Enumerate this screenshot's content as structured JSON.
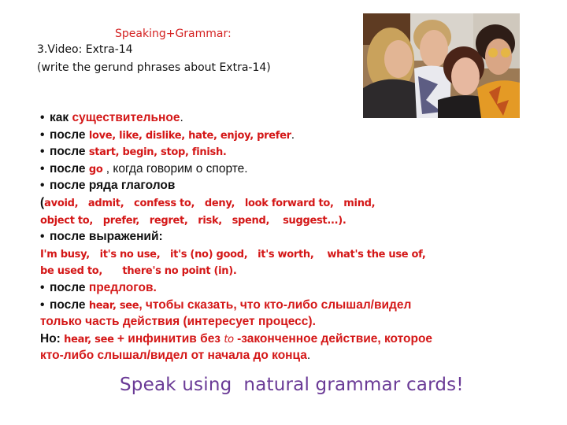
{
  "header": {
    "title": "Speaking+Grammar:",
    "video": "3.Video: Extra-14",
    "task": "(write the gerund phrases about Extra-14)"
  },
  "photo": {
    "alt": "Four cast members of Extra-14 posing together",
    "icon": "photo-image"
  },
  "colors": {
    "accent_red": "#d41717",
    "footer_purple": "#6a3a96",
    "text": "#111111"
  },
  "rules": {
    "l1": {
      "bullet": "•",
      "a": "как ",
      "b": "существительное",
      "c": "."
    },
    "l2": {
      "bullet": "•",
      "a": "после ",
      "b": "love, like, dislike, hate, enjoy, prefer",
      "c": "."
    },
    "l3": {
      "bullet": "•",
      "a": "после ",
      "b": "start, begin, stop, finish."
    },
    "l4": {
      "bullet": "•",
      "a": "после ",
      "b": "go",
      "c": " , когда говорим о спорте."
    },
    "l5": {
      "bullet": "•",
      "a": "после ряда глаголов"
    },
    "l6": {
      "a": "(",
      "b": "avoid,   admit,   confess to,   deny,   look forward to,   mind,"
    },
    "l7": {
      "b": "object to,   prefer,   regret,   risk,   spend,    suggest...)."
    },
    "l8": {
      "bullet": "•",
      "a": "после выражений:"
    },
    "l9": {
      "b": "I'm busy,   it's no use,   it's (no) good,   it's worth,    what's the use of,"
    },
    "l10": {
      "b": "be used to,      there's no point (in)."
    },
    "l11": {
      "bullet": "•",
      "a": "после ",
      "b": "предлогов."
    },
    "l12": {
      "bullet": "•",
      "a": "после ",
      "b": "hear, see",
      "c": ", чтобы сказать, что кто-либо слышал/видел"
    },
    "l13": {
      "b": "только часть действия (интересует процесс)."
    },
    "l14": {
      "a": "Но",
      "a2": ": ",
      "b": "hear, see",
      "c": " + инфинитив без ",
      "d": "to",
      "e": " -законченное действие, которое"
    },
    "l15": {
      "b": "кто-либо слышал/видел от начала до конца",
      "c": "."
    }
  },
  "footer": {
    "text": "Speak using  natural grammar cards!"
  }
}
